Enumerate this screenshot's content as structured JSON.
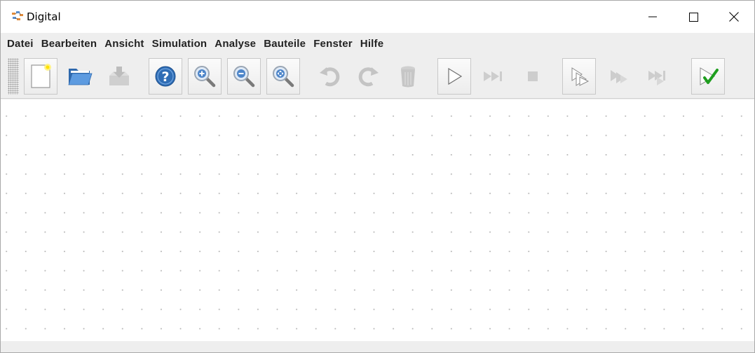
{
  "window": {
    "title": "Digital"
  },
  "menu": {
    "items": [
      "Datei",
      "Bearbeiten",
      "Ansicht",
      "Simulation",
      "Analyse",
      "Bauteile",
      "Fenster",
      "Hilfe"
    ]
  },
  "toolbar": {
    "buttons": [
      {
        "icon": "new-file-icon",
        "enabled": true
      },
      {
        "icon": "open-folder-icon",
        "enabled": true
      },
      {
        "icon": "save-icon",
        "enabled": false
      },
      {
        "icon": "help-icon",
        "enabled": true
      },
      {
        "icon": "zoom-in-icon",
        "enabled": true
      },
      {
        "icon": "zoom-out-icon",
        "enabled": true
      },
      {
        "icon": "zoom-fit-icon",
        "enabled": true
      },
      {
        "icon": "undo-icon",
        "enabled": false
      },
      {
        "icon": "redo-icon",
        "enabled": false
      },
      {
        "icon": "delete-icon",
        "enabled": false
      },
      {
        "icon": "start-simulation-icon",
        "enabled": true
      },
      {
        "icon": "step-forward-icon",
        "enabled": false
      },
      {
        "icon": "stop-simulation-icon",
        "enabled": false
      },
      {
        "icon": "micro-step-icon",
        "enabled": true
      },
      {
        "icon": "run-to-break-icon",
        "enabled": false
      },
      {
        "icon": "run-to-break-micro-icon",
        "enabled": false
      },
      {
        "icon": "run-tests-icon",
        "enabled": true
      }
    ]
  },
  "colors": {
    "window_bg": "#eeeeee",
    "canvas_bg": "#ffffff",
    "grid_dot": "#b9b9b9",
    "folder_blue": "#3f7fc8",
    "help_blue": "#2f6db5",
    "check_green": "#22aa22"
  }
}
